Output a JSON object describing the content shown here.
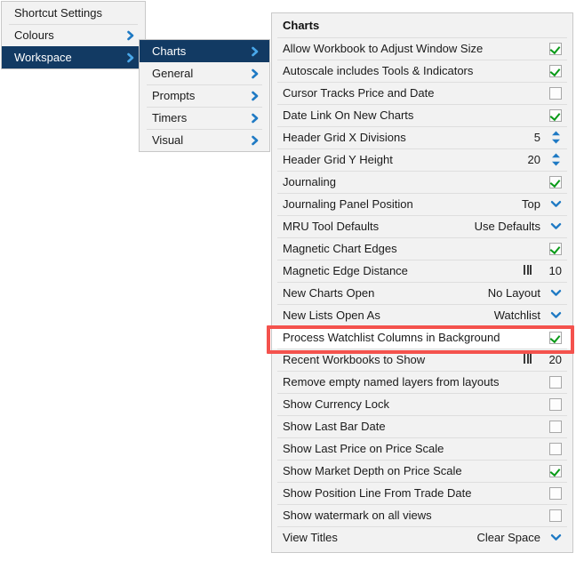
{
  "menu_level_1": {
    "items": [
      {
        "label": "Shortcut Settings",
        "has_submenu": false,
        "selected": false
      },
      {
        "label": "Colours",
        "has_submenu": true,
        "selected": false
      },
      {
        "label": "Workspace",
        "has_submenu": true,
        "selected": true
      }
    ]
  },
  "menu_level_2": {
    "items": [
      {
        "label": "Charts",
        "has_submenu": true,
        "selected": true
      },
      {
        "label": "General",
        "has_submenu": true,
        "selected": false
      },
      {
        "label": "Prompts",
        "has_submenu": true,
        "selected": false
      },
      {
        "label": "Timers",
        "has_submenu": true,
        "selected": false
      },
      {
        "label": "Visual",
        "has_submenu": true,
        "selected": false
      }
    ]
  },
  "settings_panel": {
    "header": "Charts",
    "rows": [
      {
        "label": "Allow Workbook to Adjust Window Size",
        "control": "checkbox",
        "checked": true,
        "value": ""
      },
      {
        "label": "Autoscale includes Tools & Indicators",
        "control": "checkbox",
        "checked": true,
        "value": ""
      },
      {
        "label": "Cursor Tracks Price and Date",
        "control": "checkbox",
        "checked": false,
        "value": ""
      },
      {
        "label": "Date Link On New Charts",
        "control": "checkbox",
        "checked": true,
        "value": ""
      },
      {
        "label": "Header Grid X Divisions",
        "control": "spinner",
        "checked": false,
        "value": "5"
      },
      {
        "label": "Header Grid Y Height",
        "control": "spinner",
        "checked": false,
        "value": "20"
      },
      {
        "label": "Journaling",
        "control": "checkbox",
        "checked": true,
        "value": ""
      },
      {
        "label": "Journaling Panel Position",
        "control": "dropdown",
        "checked": false,
        "value": "Top"
      },
      {
        "label": "MRU Tool Defaults",
        "control": "dropdown",
        "checked": false,
        "value": "Use Defaults"
      },
      {
        "label": "Magnetic Chart Edges",
        "control": "checkbox",
        "checked": true,
        "value": ""
      },
      {
        "label": "Magnetic Edge Distance",
        "control": "slider",
        "checked": false,
        "value": "10"
      },
      {
        "label": "New Charts Open",
        "control": "dropdown",
        "checked": false,
        "value": "No Layout"
      },
      {
        "label": "New Lists Open As",
        "control": "dropdown",
        "checked": false,
        "value": "Watchlist"
      },
      {
        "label": "Process Watchlist Columns in Background",
        "control": "checkbox",
        "checked": true,
        "value": "",
        "highlighted": true
      },
      {
        "label": "Recent Workbooks to Show",
        "control": "slider",
        "checked": false,
        "value": "20"
      },
      {
        "label": "Remove empty named layers from layouts",
        "control": "checkbox",
        "checked": false,
        "value": ""
      },
      {
        "label": "Show Currency Lock",
        "control": "checkbox",
        "checked": false,
        "value": ""
      },
      {
        "label": "Show Last Bar Date",
        "control": "checkbox",
        "checked": false,
        "value": ""
      },
      {
        "label": "Show Last Price on Price Scale",
        "control": "checkbox",
        "checked": false,
        "value": ""
      },
      {
        "label": "Show Market Depth on Price Scale",
        "control": "checkbox",
        "checked": true,
        "value": ""
      },
      {
        "label": "Show Position Line From Trade Date",
        "control": "checkbox",
        "checked": false,
        "value": ""
      },
      {
        "label": "Show watermark on all views",
        "control": "checkbox",
        "checked": false,
        "value": ""
      },
      {
        "label": "View Titles",
        "control": "dropdown",
        "checked": false,
        "value": "Clear Space"
      }
    ]
  },
  "annotation": {
    "target_row_label": "Process Watchlist Columns in Background",
    "box_color": "#f4524d"
  },
  "colors": {
    "selected_menu_bg": "#123a63",
    "panel_bg": "#f2f2f2",
    "row_highlight_bg": "#ffffff",
    "accent_blue": "#1f7ac4",
    "check_green": "#0a9a18",
    "annotation_red": "#f4524d"
  }
}
